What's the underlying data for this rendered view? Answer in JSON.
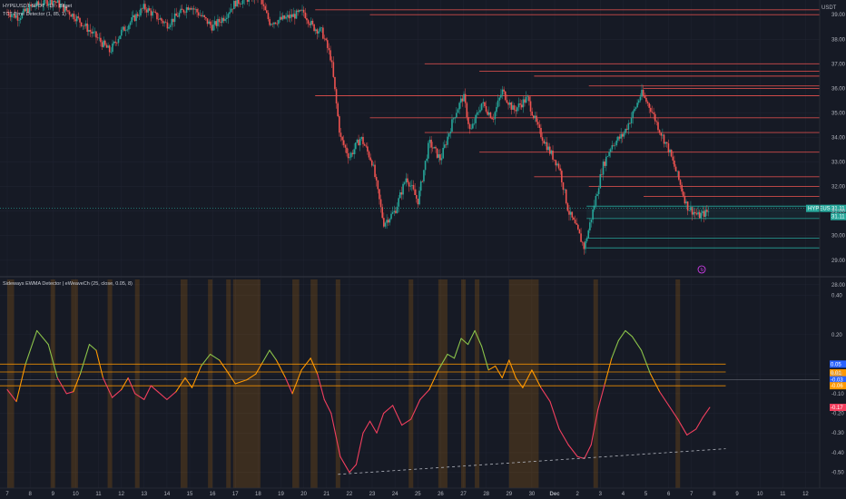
{
  "header": {
    "symbol_line": "HYPEUSDT SPOT · 1h · Bitget",
    "indicator_line": "TCT Time Detector (1, 85, 1)",
    "currency": "USDT"
  },
  "colors": {
    "background": "#161a25",
    "up": "#26a69a",
    "down": "#ef5350",
    "orange": "#ff9800",
    "green_line": "#8bc34a",
    "red_line": "#f23f5e",
    "blue_tag": "#2962ff"
  },
  "chart_data": [
    {
      "type": "candlestick",
      "title": "HYPEUSDT SPOT · 1h · Bitget",
      "ylim": [
        28.4,
        39.6
      ],
      "y_ticks": [
        "39.00",
        "38.00",
        "37.00",
        "36.00",
        "35.00",
        "34.00",
        "33.00",
        "32.00",
        "31.00",
        "30.00",
        "29.00",
        "28.00"
      ],
      "y_tick_values": [
        39,
        38,
        37,
        36,
        35,
        34,
        33,
        32,
        31,
        30,
        29,
        28
      ],
      "x_labels": [
        "7",
        "8",
        "9",
        "10",
        "11",
        "12",
        "13",
        "14",
        "15",
        "16",
        "17",
        "18",
        "19",
        "20",
        "21",
        "22",
        "23",
        "24",
        "25",
        "26",
        "27",
        "28",
        "29",
        "30",
        "Dec",
        "2",
        "3",
        "4",
        "5",
        "6",
        "7",
        "8",
        "9",
        "10",
        "11",
        "12"
      ],
      "x_range": [
        7,
        42.5
      ],
      "price_path": [
        [
          7,
          39.1
        ],
        [
          7.5,
          38.9
        ],
        [
          8,
          39.3
        ],
        [
          9,
          39.6
        ],
        [
          10,
          38.9
        ],
        [
          11,
          38.0
        ],
        [
          11.5,
          37.5
        ],
        [
          12,
          38.3
        ],
        [
          13,
          39.3
        ],
        [
          14,
          38.6
        ],
        [
          15,
          39.4
        ],
        [
          16,
          38.5
        ],
        [
          16.5,
          38.9
        ],
        [
          17,
          39.5
        ],
        [
          18,
          39.8
        ],
        [
          18.5,
          38.7
        ],
        [
          19,
          38.8
        ],
        [
          20,
          39.1
        ],
        [
          20.4,
          38.5
        ],
        [
          20.8,
          38.3
        ],
        [
          21.2,
          37.2
        ],
        [
          21.6,
          34.0
        ],
        [
          22,
          33.2
        ],
        [
          22.5,
          34.0
        ],
        [
          23,
          33.0
        ],
        [
          23.5,
          30.5
        ],
        [
          24,
          31.0
        ],
        [
          24.5,
          32.4
        ],
        [
          25,
          31.4
        ],
        [
          25.5,
          33.8
        ],
        [
          26,
          33.1
        ],
        [
          26.6,
          34.9
        ],
        [
          27,
          35.7
        ],
        [
          27.3,
          34.2
        ],
        [
          27.8,
          35.4
        ],
        [
          28.3,
          34.8
        ],
        [
          28.7,
          35.9
        ],
        [
          29.2,
          35.1
        ],
        [
          29.8,
          35.6
        ],
        [
          30.3,
          34.3
        ],
        [
          30.8,
          33.4
        ],
        [
          31.2,
          32.8
        ],
        [
          31.6,
          31.0
        ],
        [
          32,
          30.2
        ],
        [
          32.3,
          29.5
        ],
        [
          32.7,
          31.1
        ],
        [
          33.1,
          32.8
        ],
        [
          33.5,
          33.7
        ],
        [
          34,
          34.1
        ],
        [
          34.4,
          34.9
        ],
        [
          34.8,
          35.8
        ],
        [
          35.2,
          35.2
        ],
        [
          35.6,
          34.3
        ],
        [
          36,
          33.5
        ],
        [
          36.4,
          32.4
        ],
        [
          36.8,
          31.2
        ],
        [
          37.3,
          30.8
        ],
        [
          37.8,
          31.0
        ]
      ],
      "last_price_label": "HYPEUSDT",
      "last_price_values": [
        "31.11",
        "31.11"
      ],
      "last_price": 31.11,
      "supply_levels": [
        39.2,
        39.0,
        37.0,
        36.7,
        36.5,
        36.1,
        36.0,
        35.7,
        34.8,
        34.2,
        33.4,
        32.4,
        32.0,
        31.6
      ],
      "demand_levels": [
        31.2,
        30.7,
        29.9,
        29.5
      ]
    },
    {
      "type": "line",
      "title": "Sideways EWMA Detector | eWeaveCh (25, close, 0.05, 8)",
      "ylim": [
        -0.58,
        0.48
      ],
      "y_ticks": [
        "0.40",
        "0.20",
        "0.00",
        "-0.10",
        "-0.20",
        "-0.30",
        "-0.40",
        "-0.50"
      ],
      "y_tick_values": [
        0.4,
        0.2,
        0.0,
        -0.1,
        -0.2,
        -0.3,
        -0.4,
        -0.5
      ],
      "tags": [
        {
          "value": 0.05,
          "text": "0.05",
          "color": "#2962ff"
        },
        {
          "value": 0.01,
          "text": "0.01",
          "color": "#ff9800"
        },
        {
          "value": -0.03,
          "text": "-0.03",
          "color": "#2962ff"
        },
        {
          "value": -0.06,
          "text": "-0.06",
          "color": "#ff9800"
        },
        {
          "value": -0.17,
          "text": "-0.17",
          "color": "#f23f5e"
        }
      ],
      "band_upper": 0.05,
      "band_lower": -0.06,
      "band_mid": 0.01,
      "oscillator": [
        [
          7,
          -0.08
        ],
        [
          7.4,
          -0.14
        ],
        [
          7.8,
          0.05
        ],
        [
          8.3,
          0.22
        ],
        [
          8.8,
          0.15
        ],
        [
          9.2,
          -0.02
        ],
        [
          9.6,
          -0.1
        ],
        [
          9.9,
          -0.09
        ],
        [
          10.2,
          0.0
        ],
        [
          10.6,
          0.15
        ],
        [
          10.9,
          0.12
        ],
        [
          11.2,
          -0.02
        ],
        [
          11.6,
          -0.12
        ],
        [
          12,
          -0.08
        ],
        [
          12.3,
          -0.02
        ],
        [
          12.6,
          -0.1
        ],
        [
          13,
          -0.13
        ],
        [
          13.3,
          -0.06
        ],
        [
          13.6,
          -0.09
        ],
        [
          14,
          -0.13
        ],
        [
          14.4,
          -0.09
        ],
        [
          14.8,
          -0.02
        ],
        [
          15.1,
          -0.07
        ],
        [
          15.5,
          0.04
        ],
        [
          15.9,
          0.1
        ],
        [
          16.3,
          0.07
        ],
        [
          16.6,
          0.02
        ],
        [
          17,
          -0.05
        ],
        [
          17.5,
          -0.03
        ],
        [
          17.9,
          0.0
        ],
        [
          18.2,
          0.06
        ],
        [
          18.5,
          0.12
        ],
        [
          18.8,
          0.07
        ],
        [
          19.2,
          -0.02
        ],
        [
          19.5,
          -0.1
        ],
        [
          19.9,
          0.02
        ],
        [
          20.3,
          0.08
        ],
        [
          20.6,
          0.0
        ],
        [
          20.9,
          -0.13
        ],
        [
          21.2,
          -0.2
        ],
        [
          21.6,
          -0.42
        ],
        [
          22,
          -0.5
        ],
        [
          22.3,
          -0.46
        ],
        [
          22.6,
          -0.3
        ],
        [
          22.9,
          -0.24
        ],
        [
          23.2,
          -0.3
        ],
        [
          23.5,
          -0.2
        ],
        [
          23.9,
          -0.16
        ],
        [
          24.3,
          -0.26
        ],
        [
          24.7,
          -0.23
        ],
        [
          25.1,
          -0.13
        ],
        [
          25.5,
          -0.08
        ],
        [
          25.9,
          0.02
        ],
        [
          26.3,
          0.1
        ],
        [
          26.6,
          0.08
        ],
        [
          26.9,
          0.18
        ],
        [
          27.2,
          0.15
        ],
        [
          27.5,
          0.22
        ],
        [
          27.8,
          0.14
        ],
        [
          28.1,
          0.02
        ],
        [
          28.4,
          0.04
        ],
        [
          28.7,
          -0.02
        ],
        [
          29,
          0.07
        ],
        [
          29.3,
          -0.02
        ],
        [
          29.6,
          -0.07
        ],
        [
          30,
          0.02
        ],
        [
          30.4,
          -0.07
        ],
        [
          30.8,
          -0.14
        ],
        [
          31.2,
          -0.28
        ],
        [
          31.6,
          -0.36
        ],
        [
          32,
          -0.42
        ],
        [
          32.3,
          -0.43
        ],
        [
          32.6,
          -0.36
        ],
        [
          32.9,
          -0.18
        ],
        [
          33.2,
          -0.05
        ],
        [
          33.5,
          0.08
        ],
        [
          33.8,
          0.17
        ],
        [
          34.1,
          0.22
        ],
        [
          34.4,
          0.19
        ],
        [
          34.8,
          0.12
        ],
        [
          35.2,
          0.0
        ],
        [
          35.6,
          -0.09
        ],
        [
          36,
          -0.16
        ],
        [
          36.4,
          -0.23
        ],
        [
          36.8,
          -0.31
        ],
        [
          37.2,
          -0.28
        ],
        [
          37.5,
          -0.22
        ],
        [
          37.8,
          -0.17
        ]
      ],
      "trendline": [
        [
          21.5,
          -0.51
        ],
        [
          38.5,
          -0.38
        ]
      ],
      "sideways_spans": [
        [
          7.0,
          7.3
        ],
        [
          8.9,
          9.1
        ],
        [
          9.8,
          10.1
        ],
        [
          11.4,
          11.6
        ],
        [
          12.6,
          12.8
        ],
        [
          14.6,
          14.9
        ],
        [
          15.8,
          16.0
        ],
        [
          16.6,
          16.8
        ],
        [
          16.9,
          18.1
        ],
        [
          19.5,
          19.8
        ],
        [
          20.3,
          20.6
        ],
        [
          21.4,
          21.6
        ],
        [
          24.6,
          24.8
        ],
        [
          25.9,
          26.3
        ],
        [
          26.9,
          27.1
        ],
        [
          27.5,
          27.7
        ],
        [
          29.0,
          30.3
        ],
        [
          32.7,
          32.9
        ],
        [
          36.3,
          36.5
        ]
      ]
    }
  ]
}
